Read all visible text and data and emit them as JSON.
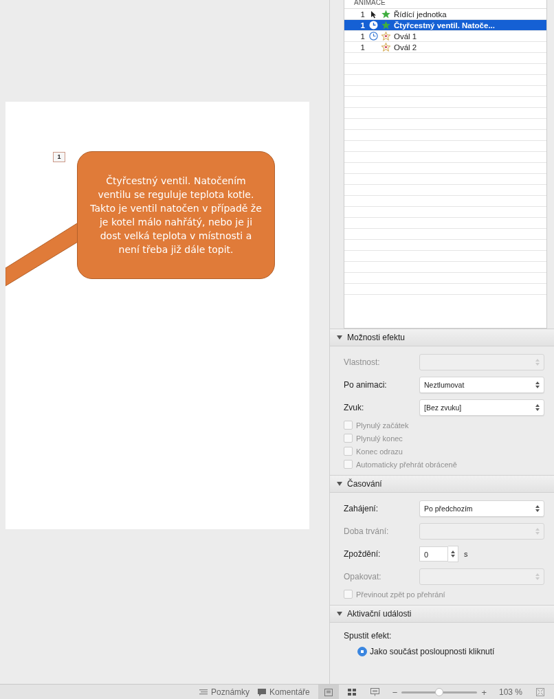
{
  "slide": {
    "badge": "1",
    "callout": "Čtyřcestný ventil. Natočením ventilu se reguluje teplota kotle. Takto je ventil natočen v případě že je kotel málo nahřátý, nebo je ji dost velká teplota v místnosti a není třeba již dále topit."
  },
  "animation_pane": {
    "header": "ANIMACE",
    "items": [
      {
        "order": "1",
        "trigger": {
          "kind": "click"
        },
        "effect": {
          "kind": "entrance"
        },
        "label": "Řídící jednotka",
        "selected": false
      },
      {
        "order": "1",
        "trigger": {
          "kind": "after"
        },
        "effect": {
          "kind": "entrance"
        },
        "label": "Čtyřcestný ventil. Natoče...",
        "selected": true
      },
      {
        "order": "1",
        "trigger": {
          "kind": "after"
        },
        "effect": {
          "kind": "emphasis"
        },
        "label": "Ovál 1",
        "selected": false
      },
      {
        "order": "1",
        "trigger": {
          "kind": "with"
        },
        "effect": {
          "kind": "emphasis"
        },
        "label": "Ovál 2",
        "selected": false
      }
    ]
  },
  "sections": [
    {
      "title": "Možnosti efektu",
      "expanded": true,
      "rows": [
        {
          "kind": "select",
          "label": "Vlastnost:",
          "disabled": true
        },
        {
          "kind": "select",
          "label": "Po animaci:",
          "value": "Neztlumovat",
          "disabled": false
        },
        {
          "kind": "select",
          "label": "Zvuk:",
          "value": "[Bez zvuku]",
          "disabled": false
        },
        {
          "kind": "checkbox",
          "label": "Plynulý začátek",
          "checked": false,
          "disabled": true
        },
        {
          "kind": "checkbox",
          "label": "Plynulý konec",
          "checked": false,
          "disabled": true
        },
        {
          "kind": "checkbox",
          "label": "Konec odrazu",
          "checked": false,
          "disabled": true
        },
        {
          "kind": "checkbox",
          "label": "Automaticky přehrát obráceně",
          "checked": false,
          "disabled": true
        }
      ]
    },
    {
      "title": "Časování",
      "expanded": true,
      "rows": [
        {
          "kind": "select",
          "label": "Zahájení:",
          "value": "Po předchozím",
          "disabled": false
        },
        {
          "kind": "select",
          "label": "Doba trvání:",
          "disabled": true
        },
        {
          "kind": "number",
          "label": "Zpoždění:",
          "value": "0",
          "unit": "s",
          "disabled": false
        },
        {
          "kind": "select",
          "label": "Opakovat:",
          "disabled": true
        },
        {
          "kind": "checkbox",
          "label": "Převinout zpět po přehrání",
          "checked": false,
          "disabled": true
        }
      ]
    },
    {
      "title": "Aktivační události",
      "expanded": true,
      "rows": [
        {
          "kind": "text",
          "label": "Spustit efekt:"
        },
        {
          "kind": "radio",
          "label": "Jako součást posloupnosti kliknutí",
          "selected": true
        }
      ]
    }
  ],
  "status_bar": {
    "notes": "Poznámky",
    "comments": "Komentáře",
    "views": [
      {
        "kind": "normal",
        "selected": true
      },
      {
        "kind": "sorter",
        "selected": false
      },
      {
        "kind": "presenter",
        "selected": false
      }
    ],
    "zoom": {
      "minus": "−",
      "plus": "+",
      "level": 0.5,
      "value": "103 %"
    }
  }
}
